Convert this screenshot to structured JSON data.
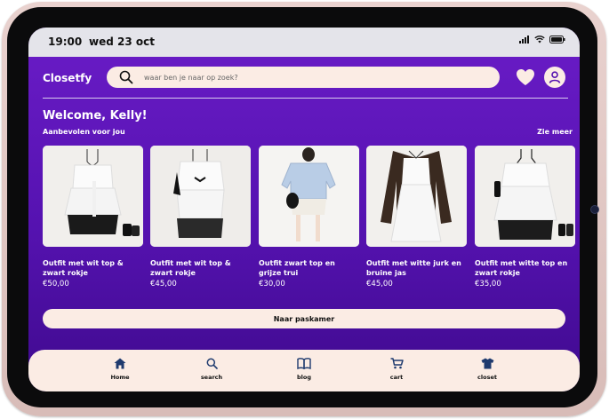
{
  "status_bar": {
    "time": "19:00",
    "date": "wed 23 oct"
  },
  "header": {
    "brand": "Closetfy",
    "search_placeholder": "waar ben je naar op zoek?",
    "icons": [
      "search-icon",
      "heart-icon",
      "user-icon"
    ]
  },
  "main": {
    "welcome": "Welcome, Kelly!",
    "section_title": "Aanbevolen voor jou",
    "see_more": "Zie meer",
    "cards": [
      {
        "title": "Outfit met wit top & zwart rokje",
        "price": "€50,00"
      },
      {
        "title": "Outfit met wit top & zwart rokje",
        "price": "€45,00"
      },
      {
        "title": "Outfit zwart top en grijze trui",
        "price": "€30,00"
      },
      {
        "title": "Outfit met witte jurk en bruine jas",
        "price": "€45,00"
      },
      {
        "title": "Outfit met witte top en zwart rokje",
        "price": "€35,00"
      }
    ],
    "cta": "Naar paskamer"
  },
  "nav": {
    "items": [
      {
        "label": "Home",
        "icon": "home-icon"
      },
      {
        "label": "search",
        "icon": "search-icon"
      },
      {
        "label": "blog",
        "icon": "book-icon"
      },
      {
        "label": "cart",
        "icon": "cart-icon"
      },
      {
        "label": "closet",
        "icon": "shirt-icon"
      }
    ]
  },
  "colors": {
    "purple_top": "#6a1cc7",
    "purple_bottom": "#3f0a8e",
    "cream": "#fbece4",
    "navy_icon": "#1e3a6e"
  }
}
